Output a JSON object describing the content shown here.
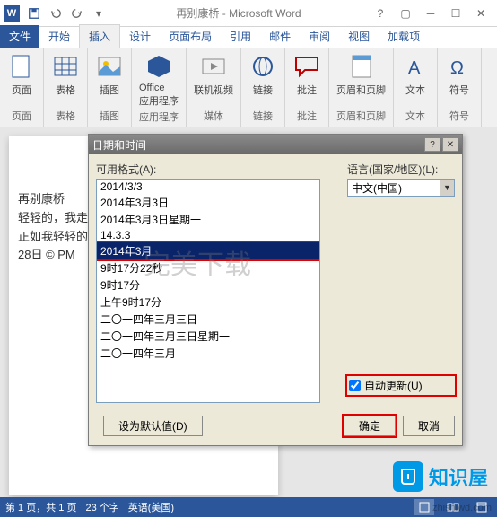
{
  "title": "再别康桥 - Microsoft Word",
  "qat": {
    "save": "保存",
    "undo": "撤销",
    "redo": "重做"
  },
  "tabs": {
    "file": "文件",
    "home": "开始",
    "insert": "插入",
    "design": "设计",
    "layout": "页面布局",
    "references": "引用",
    "mailings": "邮件",
    "review": "审阅",
    "view": "视图",
    "addins": "加载项"
  },
  "ribbon": {
    "pages": {
      "label": "页面",
      "item": "页面"
    },
    "tables": {
      "label": "表格",
      "item": "表格"
    },
    "illustrations": {
      "label": "插图",
      "item": "插图"
    },
    "apps": {
      "label": "应用程序",
      "item": "Office\n应用程序"
    },
    "media": {
      "label": "媒体",
      "item": "联机视频"
    },
    "links": {
      "label": "链接",
      "item": "链接"
    },
    "comments": {
      "label": "批注",
      "item": "批注"
    },
    "headerfooter": {
      "label": "页眉和页脚",
      "item": "页眉和页脚"
    },
    "text": {
      "label": "文本",
      "item": "文本"
    },
    "symbols": {
      "label": "符号",
      "item": "符号"
    }
  },
  "document": {
    "line1": "再别康桥",
    "line2": "轻轻的，我走了",
    "line3": "正如我轻轻的来",
    "line4": "28日  ©  PM"
  },
  "dialog": {
    "title": "日期和时间",
    "formats_label": "可用格式(A):",
    "language_label": "语言(国家/地区)(L):",
    "language_value": "中文(中国)",
    "auto_update": "自动更新(U)",
    "set_default": "设为默认值(D)",
    "ok": "确定",
    "cancel": "取消",
    "formats": [
      "2014/3/3",
      "2014年3月3日",
      "2014年3月3日星期一",
      "14.3.3",
      "2014年3月",
      "9时17分22秒",
      "9时17分",
      "上午9时17分",
      "二〇一四年三月三日",
      "二〇一四年三月三日星期一",
      "二〇一四年三月"
    ],
    "selected_index": 4
  },
  "watermark": {
    "text": "完美下载",
    "brand": "知识屋",
    "url": "zhishiwd.com"
  },
  "status": {
    "page": "第 1 页，共 1 页",
    "words": "23 个字",
    "lang": "英语(美国)"
  }
}
